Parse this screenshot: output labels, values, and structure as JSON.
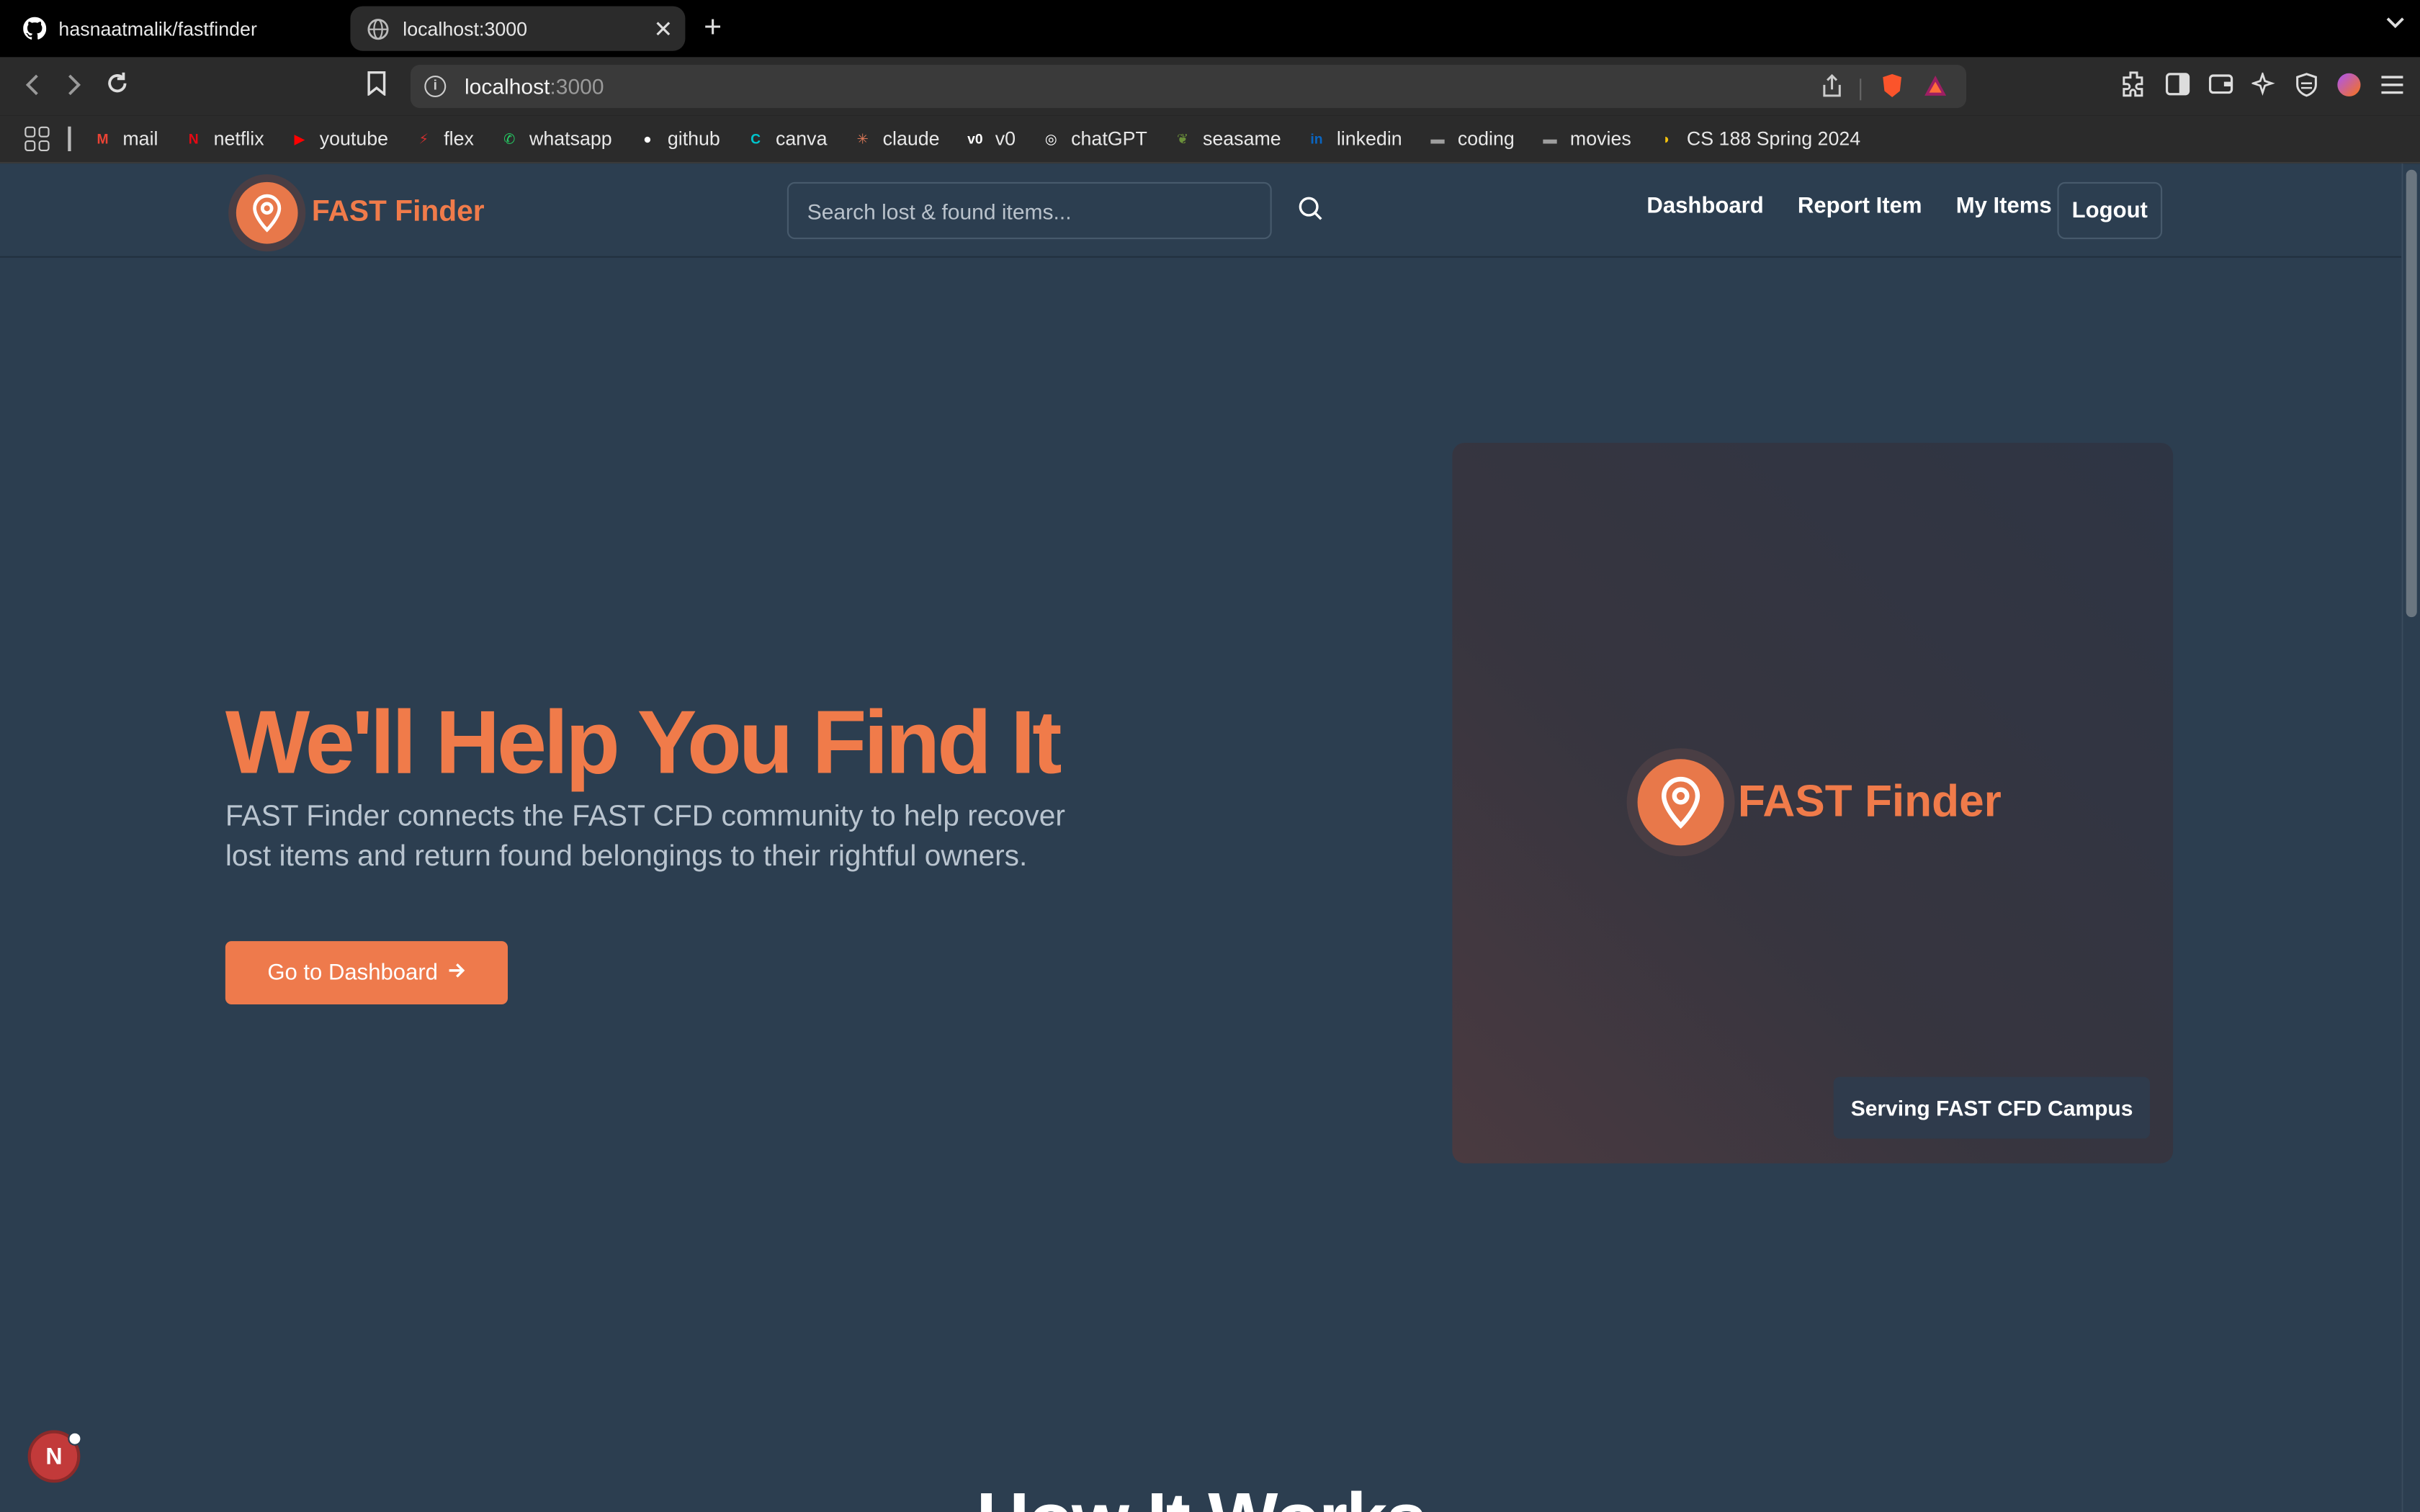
{
  "browser": {
    "tabs": [
      {
        "label": "hasnaatmalik/fastfinder",
        "icon": "github-icon"
      },
      {
        "label": "localhost:3000",
        "icon": "globe-icon"
      }
    ],
    "address": {
      "host": "localhost",
      "port": ":3000"
    },
    "bookmarks": [
      {
        "label": "mail",
        "color": "#ea4335"
      },
      {
        "label": "netflix",
        "color": "#e50914"
      },
      {
        "label": "youtube",
        "color": "#ff0000"
      },
      {
        "label": "flex",
        "color": "#d32f2f"
      },
      {
        "label": "whatsapp",
        "color": "#25d366"
      },
      {
        "label": "github",
        "color": "#ffffff"
      },
      {
        "label": "canva",
        "color": "#00c4cc"
      },
      {
        "label": "claude",
        "color": "#d97757"
      },
      {
        "label": "v0",
        "color": "#ffffff"
      },
      {
        "label": "chatGPT",
        "color": "#ffffff"
      },
      {
        "label": "seasame",
        "color": "#6a8f3a"
      },
      {
        "label": "linkedin",
        "color": "#0a66c2"
      },
      {
        "label": "coding",
        "color": "#9e9e9e"
      },
      {
        "label": "movies",
        "color": "#9e9e9e"
      },
      {
        "label": "CS 188 Spring 2024",
        "color": "#f4c20d"
      }
    ]
  },
  "nav": {
    "brand": "FAST Finder",
    "search_placeholder": "Search lost & found items...",
    "links": [
      "Dashboard",
      "Report Item",
      "My Items"
    ],
    "logout": "Logout"
  },
  "hero": {
    "title": "We'll Help You Find It",
    "description": "FAST Finder connects the FAST CFD community to help recover lost items and return found belongings to their rightful owners.",
    "cta": "Go to Dashboard",
    "card_brand": "FAST Finder",
    "card_badge": "Serving FAST CFD Campus"
  },
  "section": {
    "title": "How It Works"
  },
  "dev_badge": "N",
  "colors": {
    "accent": "#f07b4a",
    "background": "#2c3e50"
  }
}
